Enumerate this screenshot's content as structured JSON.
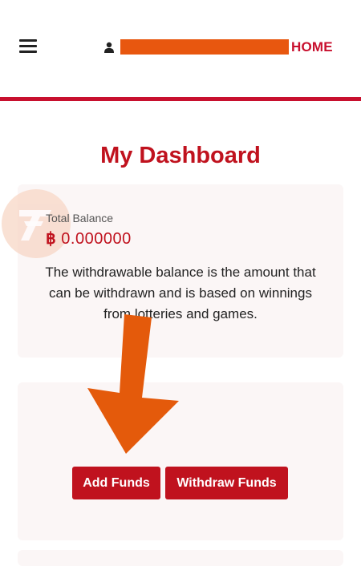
{
  "header": {
    "menu_icon": "hamburger-menu-icon",
    "user_icon": "user-icon",
    "home_label": "HOME"
  },
  "colors": {
    "brand_red": "#C0121E",
    "redaction_orange": "#E8570F",
    "card_background": "#FBF6F6",
    "arrow_orange": "#E45A0B"
  },
  "page_title": "My Dashboard",
  "balance": {
    "label": "Total Balance",
    "currency_symbol": "฿",
    "amount": "0.000000",
    "description": "The withdrawable balance is the amount that can be withdrawn and is based on winnings from lotteries and games."
  },
  "actions": {
    "add_funds": "Add Funds",
    "withdraw_funds": "Withdraw Funds"
  }
}
